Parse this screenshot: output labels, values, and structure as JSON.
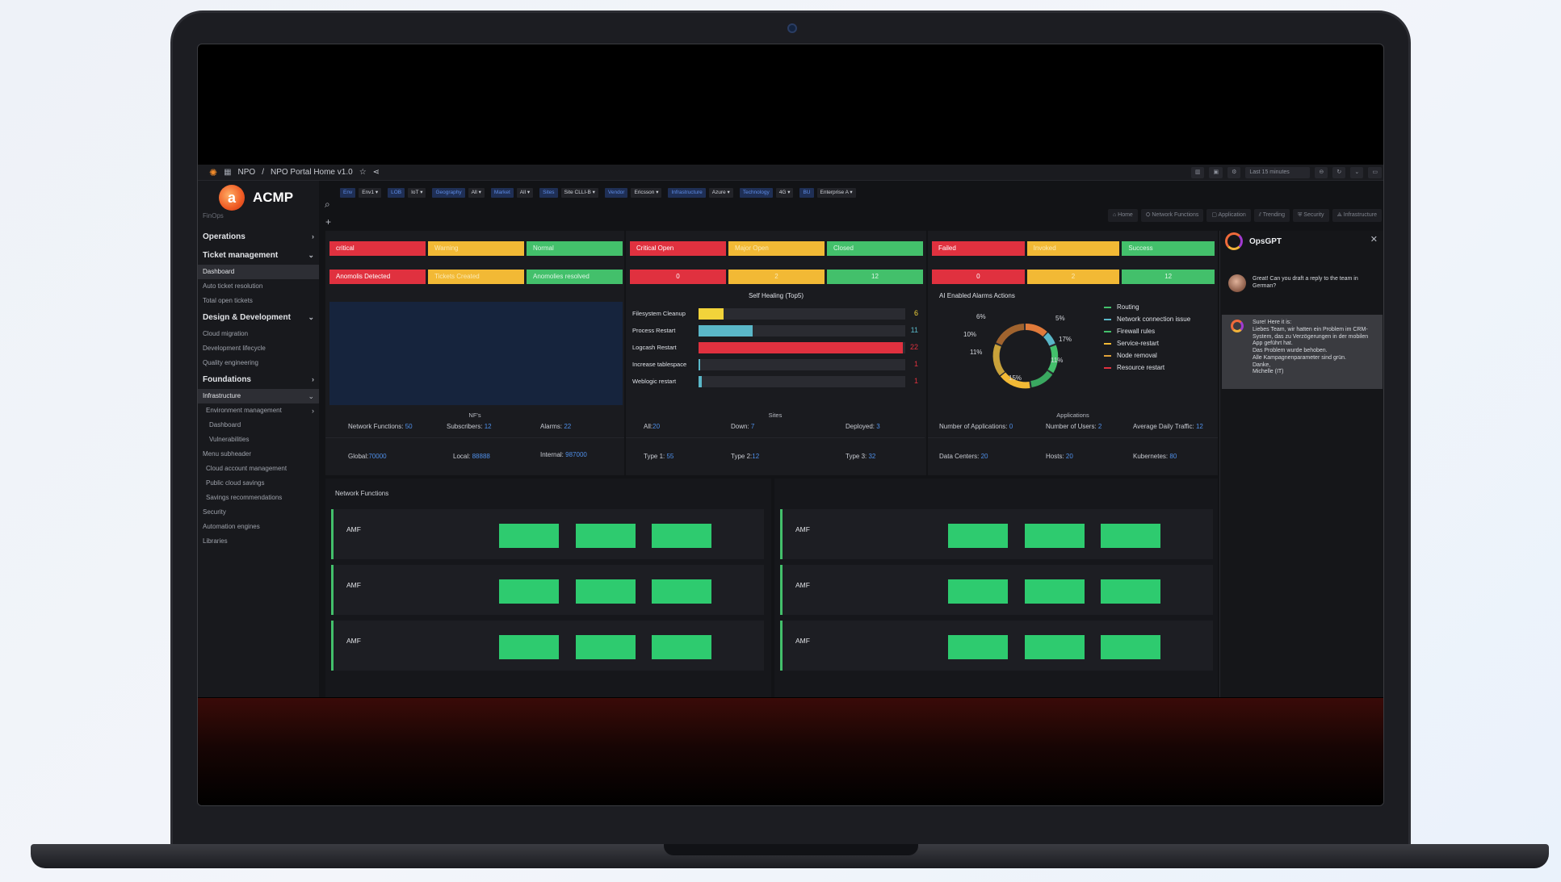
{
  "topbar": {
    "logo_icon": "grafana-icon",
    "breadcrumb_root": "NPO",
    "breadcrumb_sep": "/",
    "breadcrumb_page": "NPO Portal Home v1.0",
    "time_range": "Last 15 minutes"
  },
  "sidebar": {
    "logo_text": "ACMP",
    "logo_letter": "a",
    "section_label": "FinOps",
    "items": [
      {
        "label": "Operations",
        "type": "head",
        "chevron": "›"
      },
      {
        "label": "Ticket management",
        "type": "head",
        "chevron": "⌄"
      },
      {
        "label": "Dashboard",
        "type": "sub",
        "active": true
      },
      {
        "label": "Auto ticket resolution",
        "type": "sub"
      },
      {
        "label": "Total open tickets",
        "type": "sub"
      },
      {
        "label": "Design & Development",
        "type": "head",
        "chevron": "⌄"
      },
      {
        "label": "Cloud migration",
        "type": "sub"
      },
      {
        "label": "Development lifecycle",
        "type": "sub"
      },
      {
        "label": "Quality engineering",
        "type": "sub"
      },
      {
        "label": "Foundations",
        "type": "head",
        "chevron": "›"
      },
      {
        "label": "Infrastructure",
        "type": "sub-active",
        "chevron": "⌄"
      },
      {
        "label": "Environment management",
        "type": "sub2",
        "chevron": "›"
      },
      {
        "label": "Dashboard",
        "type": "sub3"
      },
      {
        "label": "Vulnerabilities",
        "type": "sub3"
      },
      {
        "label": "Menu subheader",
        "type": "sub"
      },
      {
        "label": "Cloud account management",
        "type": "sub2"
      },
      {
        "label": "Public cloud savings",
        "type": "sub2"
      },
      {
        "label": "Savings recommendations",
        "type": "sub2"
      },
      {
        "label": "Security",
        "type": "sub"
      },
      {
        "label": "Automation engines",
        "type": "sub"
      },
      {
        "label": "Libraries",
        "type": "sub"
      }
    ]
  },
  "filters": [
    {
      "label": "Env",
      "value": "Env1 ▾"
    },
    {
      "label": "LOB",
      "value": "IoT ▾"
    },
    {
      "label": "Geography",
      "value": "All ▾"
    },
    {
      "label": "Market",
      "value": "All ▾"
    },
    {
      "label": "Sites",
      "value": "Site CLLI-B ▾"
    },
    {
      "label": "Vendor",
      "value": "Ericsson ▾"
    },
    {
      "label": "Infrastructure",
      "value": "Azure ▾"
    },
    {
      "label": "Technology",
      "value": "4G ▾"
    },
    {
      "label": "BU",
      "value": "Enterprise A ▾"
    }
  ],
  "nav_tabs": [
    "⌂ Home",
    "⛭ Network Functions",
    "▢ Application",
    "⫽ Trending",
    "⛨ Security",
    "⟁ Infrastructure"
  ],
  "panel_nf": {
    "status_top": [
      "critical",
      "Warning",
      "Normal"
    ],
    "status_bottom": [
      "Anomolis Detected",
      "Tickets Created",
      "Anomolies resolved"
    ],
    "stats_title": "NF's",
    "stats": [
      {
        "label": "Network Functions:",
        "value": "50"
      },
      {
        "label": "Subscribers:",
        "value": "12"
      },
      {
        "label": "Alarms:",
        "value": "22"
      },
      {
        "label": "Global:",
        "value": "70000"
      },
      {
        "label": "Local:",
        "value": "88888"
      },
      {
        "label": "Internal:",
        "value": "987000"
      }
    ]
  },
  "panel_sites": {
    "status_top": [
      "Critical Open",
      "Major Open",
      "Closed"
    ],
    "status_bottom": [
      "0",
      "2",
      "12"
    ],
    "heal_title": "Self Healing (Top5)",
    "bars": [
      {
        "label": "Filesystem Cleanup",
        "value": 6,
        "color": "#f2d33a",
        "fill": 0.12
      },
      {
        "label": "Process Restart",
        "value": 11,
        "color": "#5ab7c8",
        "fill": 0.26
      },
      {
        "label": "Logcash Restart",
        "value": 22,
        "color": "#e0313f",
        "fill": 0.99
      },
      {
        "label": "Increase tablespace",
        "value": 1,
        "color": "#5ab7c8",
        "fill": 0.005
      },
      {
        "label": "Weblogic restart",
        "value": 1,
        "color": "#5ab7c8",
        "fill": 0.015
      }
    ],
    "stats_title": "Sites",
    "stats": [
      {
        "label": "All:",
        "value": "20"
      },
      {
        "label": "Down:",
        "value": "7"
      },
      {
        "label": "Deployed:",
        "value": "3"
      },
      {
        "label": "Type 1:",
        "value": "55"
      },
      {
        "label": "Type 2:",
        "value": "12"
      },
      {
        "label": "Type 3:",
        "value": "32"
      }
    ]
  },
  "panel_apps": {
    "status_top": [
      "Failed",
      "Invoked",
      "Success"
    ],
    "status_bottom": [
      "0",
      "2",
      "12"
    ],
    "donut_title": "AI Enabled Alarms Actions",
    "donut_pcts": [
      "6%",
      "5%",
      "10%",
      "17%",
      "11%",
      "11%",
      "15%"
    ],
    "legend": [
      {
        "label": "Routing",
        "color": "#43c06b"
      },
      {
        "label": "Network connection issue",
        "color": "#5ab7c8"
      },
      {
        "label": "Firewall rules",
        "color": "#43c06b"
      },
      {
        "label": "Service-restart",
        "color": "#f2b935"
      },
      {
        "label": "Node removal",
        "color": "#e0a23a"
      },
      {
        "label": "Resource restart",
        "color": "#e0313f"
      }
    ],
    "stats_title": "Applications",
    "stats": [
      {
        "label": "Number of Applications:",
        "value": "0"
      },
      {
        "label": "Number of Users:",
        "value": "2"
      },
      {
        "label": "Average Daily Traffic:",
        "value": "12"
      },
      {
        "label": "Data Centers:",
        "value": "20"
      },
      {
        "label": "Hosts:",
        "value": "20"
      },
      {
        "label": "Kubernetes:",
        "value": "80"
      }
    ]
  },
  "network_functions": {
    "title": "Network Functions",
    "left": [
      "AMF",
      "AMF",
      "AMF"
    ],
    "right": [
      "AMF",
      "AMF",
      "AMF"
    ]
  },
  "opsgpt": {
    "title": "OpsGPT",
    "close": "✕",
    "user_message": "Great! Can you draft a reply to the team in German?",
    "ai_message": "Sure! Here it is:\nLiebes Team, wir hatten ein Problem im CRM-System, das zu Verzögerungen in der mobilen App geführt hat.\nDas Problem wurde behoben.\nAlle Kampagnenparameter sind grün.\nDanke,\nMichelle (IT)"
  }
}
